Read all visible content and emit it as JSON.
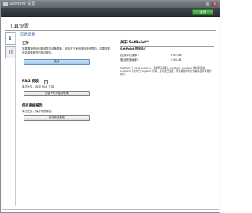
{
  "window": {
    "title": "SetPoint 设置"
  },
  "ribbon": {
    "home_label": "主页"
  },
  "page": {
    "title": "工具设置"
  },
  "sidebar": {
    "tab1_glyph": "ℹ",
    "tab2_glyph": "Ti"
  },
  "info_section": {
    "title": "信息资源"
  },
  "support": {
    "label": "支持",
    "description": "如果遇到任何问题请寻求设备帮助。请单击下面的按钮获得帮助。如果需要的话请更新您的驱动程序。",
    "button": "支持"
  },
  "ps2": {
    "label": "PS/2 安装",
    "description": "单击此处，启用 PS/2 支持。",
    "button": "安装 PS/2 驱动程序"
  },
  "report": {
    "label": "保存系统报告",
    "description": "单击此处，保存系统报告。",
    "button": "保存系统报告"
  },
  "about": {
    "title": "关于 SetPoint™",
    "product": "SetPoint 控制中心",
    "rows": [
      {
        "label": "控制中心版本：",
        "value": "6.67.83"
      },
      {
        "label": "驱动程序版本：",
        "value": "5.80.41"
      }
    ],
    "legal": "SetPoint © 2014 Logitech。保留所有权利。Logitech、Logitech 徽标和其他 Logitech 标志均归 Logitech 所有，且可能已注册。所有其他商标均为其各自所有者的财产。"
  }
}
